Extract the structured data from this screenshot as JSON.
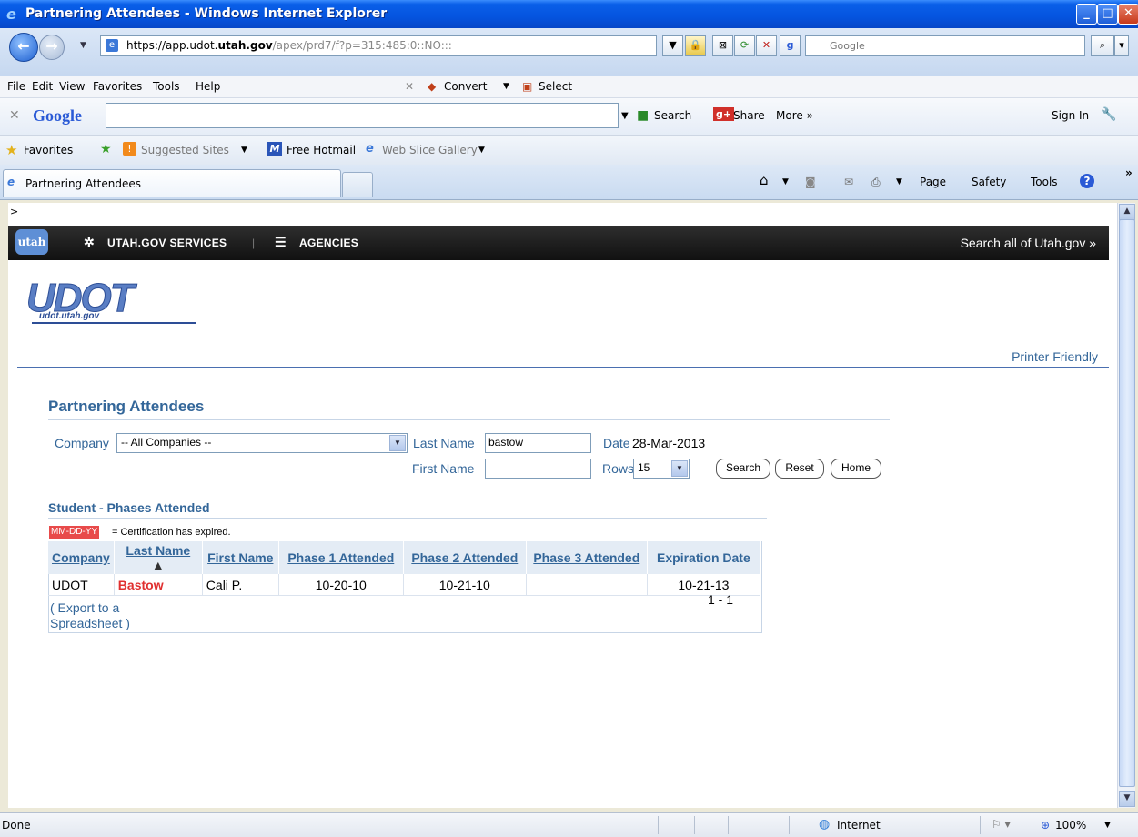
{
  "window": {
    "title": "Partnering Attendees - Windows Internet Explorer"
  },
  "browser": {
    "url_host": "https://app.udot.",
    "url_domain": "utah.gov",
    "url_path": "/apex/prd7/f?p=315:485:0::NO:::",
    "search_placeholder": "Google",
    "menus": [
      "File",
      "Edit",
      "View",
      "Favorites",
      "Tools",
      "Help"
    ],
    "convert_label": "Convert",
    "select_label": "Select",
    "google_toolbar": {
      "logo": "Google",
      "search_label": "Search",
      "share_label": "Share",
      "more_label": "More »",
      "signin_label": "Sign In"
    },
    "favorites": {
      "favorites_label": "Favorites",
      "suggested_label": "Suggested Sites",
      "hotmail_label": "Free Hotmail",
      "webslice_label": "Web Slice Gallery"
    },
    "tab_title": "Partnering Attendees",
    "command_bar": {
      "page_label": "Page",
      "safety_label": "Safety",
      "tools_label": "Tools"
    },
    "status": {
      "left": "Done",
      "zone": "Internet",
      "zoom": "100%"
    }
  },
  "page": {
    "breadcrumb_marker": ">",
    "utah_logo": "utah gov",
    "services_label": "UTAH.GOV SERVICES",
    "agencies_label": "AGENCIES",
    "search_all_label": "Search all of Utah.gov »",
    "udot_logo": "UDOT",
    "udot_sub": "udot.utah.gov",
    "printer_friendly": "Printer Friendly",
    "report_title": "Partnering Attendees",
    "filters": {
      "company_label": "Company",
      "company_value": "-- All Companies --",
      "last_name_label": "Last Name",
      "last_name_value": "bastow",
      "date_label": "Date",
      "date_value": "28-Mar-2013",
      "first_name_label": "First Name",
      "first_name_value": "",
      "rows_label": "Rows",
      "rows_value": "15",
      "search_button": "Search",
      "reset_button": "Reset",
      "home_button": "Home"
    },
    "section_title": "Student - Phases Attended",
    "legend": {
      "swatch": "MM-DD-YY",
      "text": "= Certification has expired."
    },
    "table": {
      "headers": [
        "Company",
        "Last Name",
        "First Name",
        "Phase 1 Attended",
        "Phase 2 Attended",
        "Phase 3 Attended",
        "Expiration Date"
      ],
      "sort_indicator": "▲",
      "rows": [
        [
          "UDOT",
          "Bastow",
          "Cali P.",
          "10-20-10",
          "10-21-10",
          "",
          "10-21-13"
        ]
      ],
      "pagination": "1 - 1",
      "export_line1": "( Export to a",
      "export_line2": "Spreadsheet )"
    },
    "colors": {
      "accent": "#336699",
      "expired": "#e03030"
    }
  }
}
